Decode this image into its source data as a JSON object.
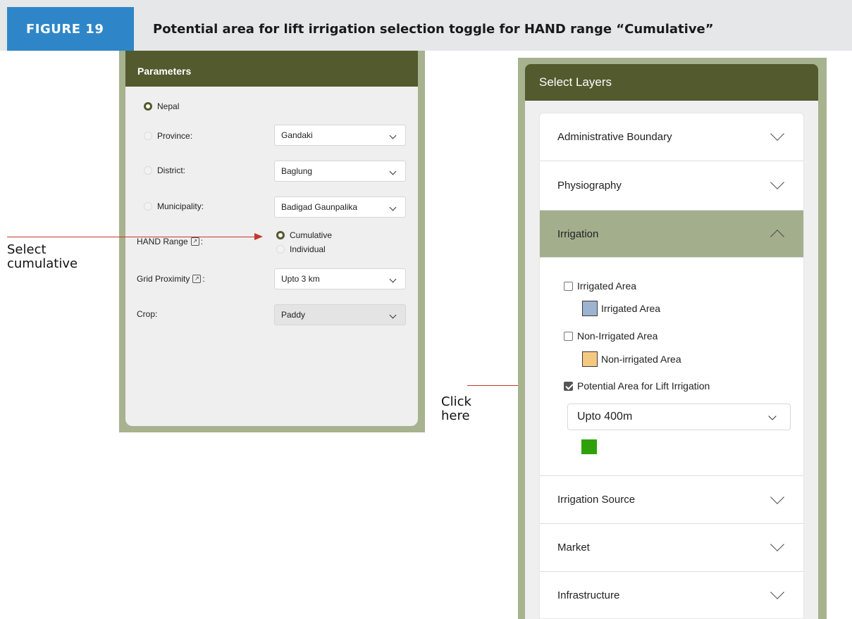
{
  "figure": {
    "number": "FIGURE 19",
    "title": "Potential area for lift irrigation selection toggle for HAND range “Cumulative”"
  },
  "parameters": {
    "header": "Parameters",
    "nepal_label": "Nepal",
    "province_label": "Province:",
    "province_value": "Gandaki",
    "district_label": "District:",
    "district_value": "Baglung",
    "municipality_label": "Municipality:",
    "municipality_value": "Badigad Gaunpalika",
    "hand_range_label": "HAND Range",
    "hand_range_suffix": ":",
    "hand_options": [
      "Cumulative",
      "Individual"
    ],
    "grid_proximity_label": "Grid Proximity",
    "grid_proximity_suffix": ":",
    "grid_proximity_value": "Upto 3 km",
    "crop_label": "Crop:",
    "crop_value": "Paddy"
  },
  "annotations": {
    "select_cumulative": [
      "Select",
      "cumulative"
    ],
    "click_here": [
      "Click",
      "here"
    ]
  },
  "layers": {
    "header": "Select Layers",
    "sections": [
      "Administrative Boundary",
      "Physiography",
      "Irrigation",
      "Irrigation Source",
      "Market",
      "Infrastructure"
    ],
    "irrigated_area_checkbox": "Irrigated Area",
    "irrigated_area_legend": "Irrigated Area",
    "non_irrigated_checkbox": "Non-Irrigated Area",
    "non_irrigated_legend": "Non-irrigated Area",
    "lift_irrigation_checkbox": "Potential Area for Lift Irrigation",
    "lift_irrigation_value": "Upto 400m"
  },
  "colors": {
    "brand_dark": "#525a2e",
    "irrigated_swatch": "#9db4d1",
    "non_irrigated_swatch": "#f5c882",
    "lift_irrigation_swatch": "#2ea10a",
    "annotation_arrow": "#c0392b"
  },
  "icons": {
    "external_link": "external-link-icon",
    "dropdown": "chevron-down-icon",
    "collapse": "chevron-up-icon"
  }
}
